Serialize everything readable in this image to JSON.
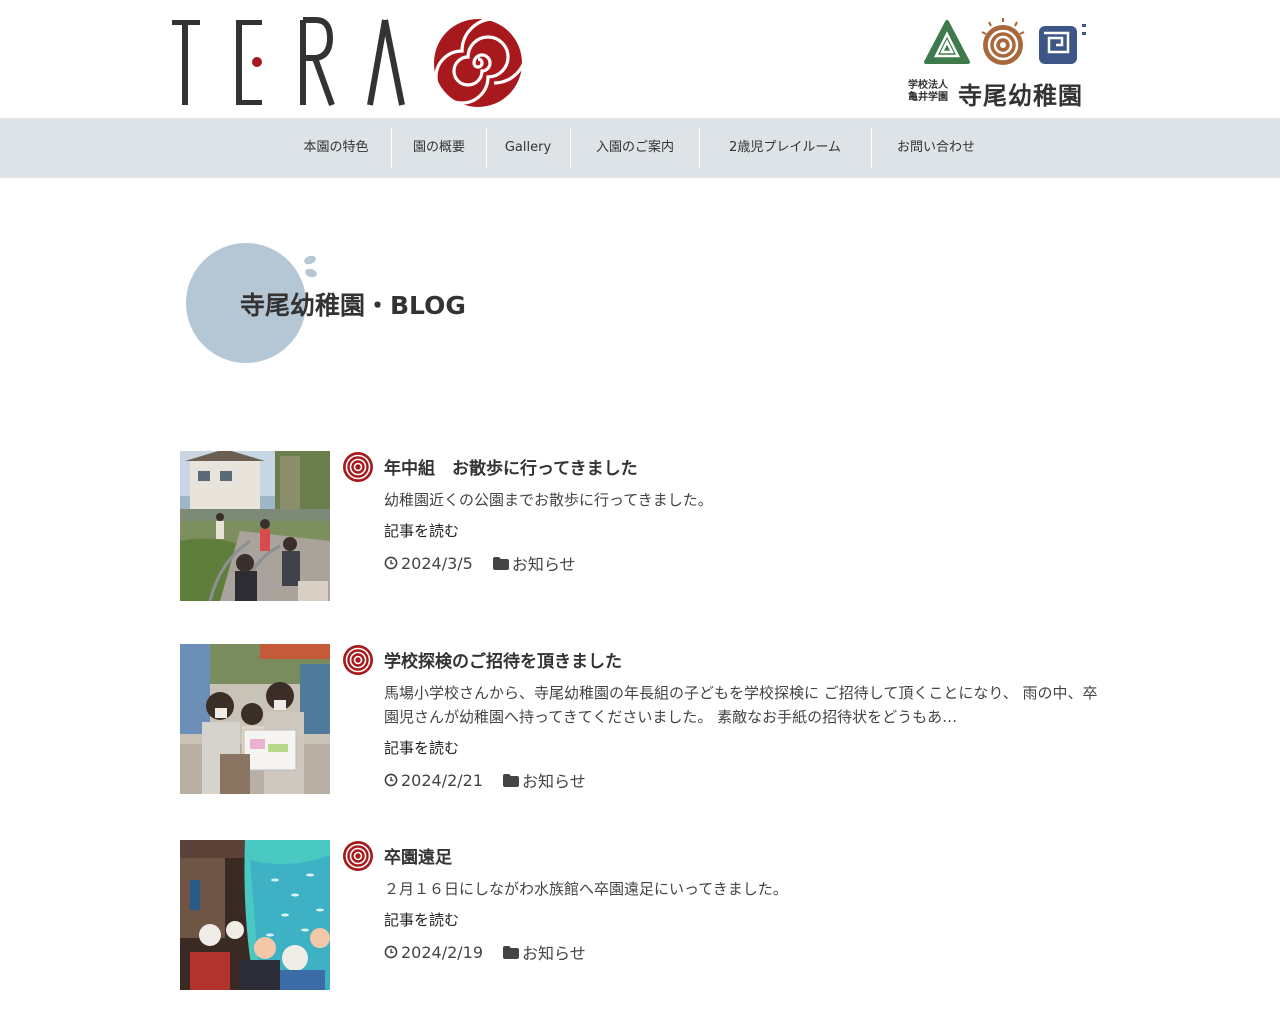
{
  "header": {
    "brand_letters": [
      "T",
      "E",
      "R",
      "A"
    ],
    "school_corp_line1": "学校法人",
    "school_corp_line2": "亀井学園",
    "school_name": "寺尾幼稚園"
  },
  "nav": {
    "items": [
      {
        "label": "本園の特色"
      },
      {
        "label": "園の概要"
      },
      {
        "label": "Gallery"
      },
      {
        "label": "入園のご案内"
      },
      {
        "label": "2歳児プレイルーム"
      },
      {
        "label": "お問い合わせ"
      }
    ]
  },
  "page": {
    "title": "寺尾幼稚園・BLOG"
  },
  "colors": {
    "brand_red": "#a8191e",
    "nav_bg": "#dde3e6",
    "title_circle": "#b5c7d4",
    "logo_green": "#3e7a4c",
    "logo_brown": "#a8683c",
    "logo_blue": "#3c5787"
  },
  "posts": [
    {
      "title": "年中組　お散歩に行ってきました",
      "excerpt": "幼稚園近くの公園までお散歩に行ってきました。",
      "read_more": "記事を読む",
      "date": "2024/3/5",
      "category": "お知らせ",
      "icon": "spiral-icon"
    },
    {
      "title": "学校探検のご招待を頂きました",
      "excerpt": "馬場小学校さんから、寺尾幼稚園の年長組の子どもを学校探検に ご招待して頂くことになり、 雨の中、卒園児さんが幼稚園へ持ってきてくださいました。 素敵なお手紙の招待状をどうもあ…",
      "read_more": "記事を読む",
      "date": "2024/2/21",
      "category": "お知らせ",
      "icon": "spiral-icon"
    },
    {
      "title": "卒園遠足",
      "excerpt": "２月１６日にしながわ水族館へ卒園遠足にいってきました。",
      "read_more": "記事を読む",
      "date": "2024/2/19",
      "category": "お知らせ",
      "icon": "spiral-icon"
    }
  ]
}
